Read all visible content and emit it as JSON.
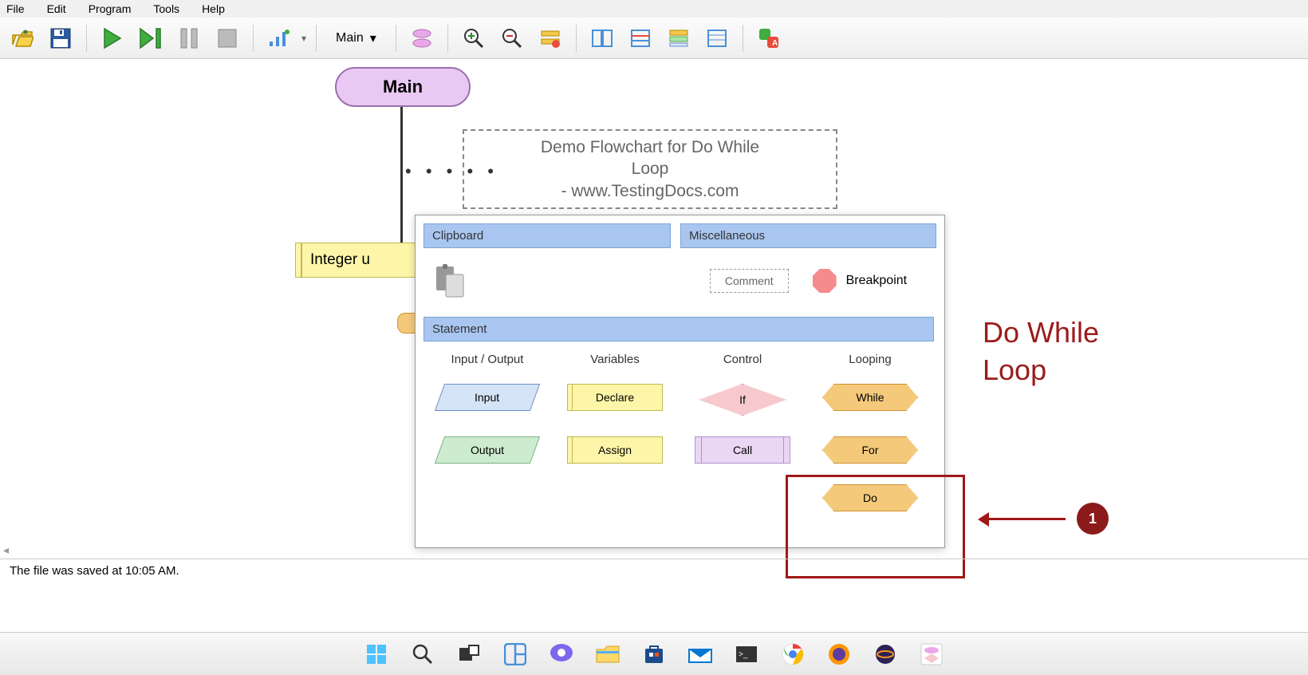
{
  "menu": {
    "file": "File",
    "edit": "Edit",
    "program": "Program",
    "tools": "Tools",
    "help": "Help"
  },
  "toolbar": {
    "scope": "Main"
  },
  "flow": {
    "main_label": "Main",
    "comment_line1": "Demo Flowchart for Do While",
    "comment_line2": "Loop",
    "comment_line3": "- www.TestingDocs.com",
    "declare_text": "Integer u"
  },
  "ctx": {
    "clipboard": "Clipboard",
    "misc": "Miscellaneous",
    "comment": "Comment",
    "breakpoint": "Breakpoint",
    "statement": "Statement",
    "cols": {
      "io": "Input / Output",
      "vars": "Variables",
      "ctrl": "Control",
      "loop": "Looping"
    },
    "shapes": {
      "input": "Input",
      "output": "Output",
      "declare": "Declare",
      "assign": "Assign",
      "if": "If",
      "call": "Call",
      "while": "While",
      "for": "For",
      "do": "Do"
    }
  },
  "annot": {
    "title1": "Do While",
    "title2": "Loop",
    "num": "1"
  },
  "status": {
    "text": "The file was saved at 10:05 AM."
  }
}
